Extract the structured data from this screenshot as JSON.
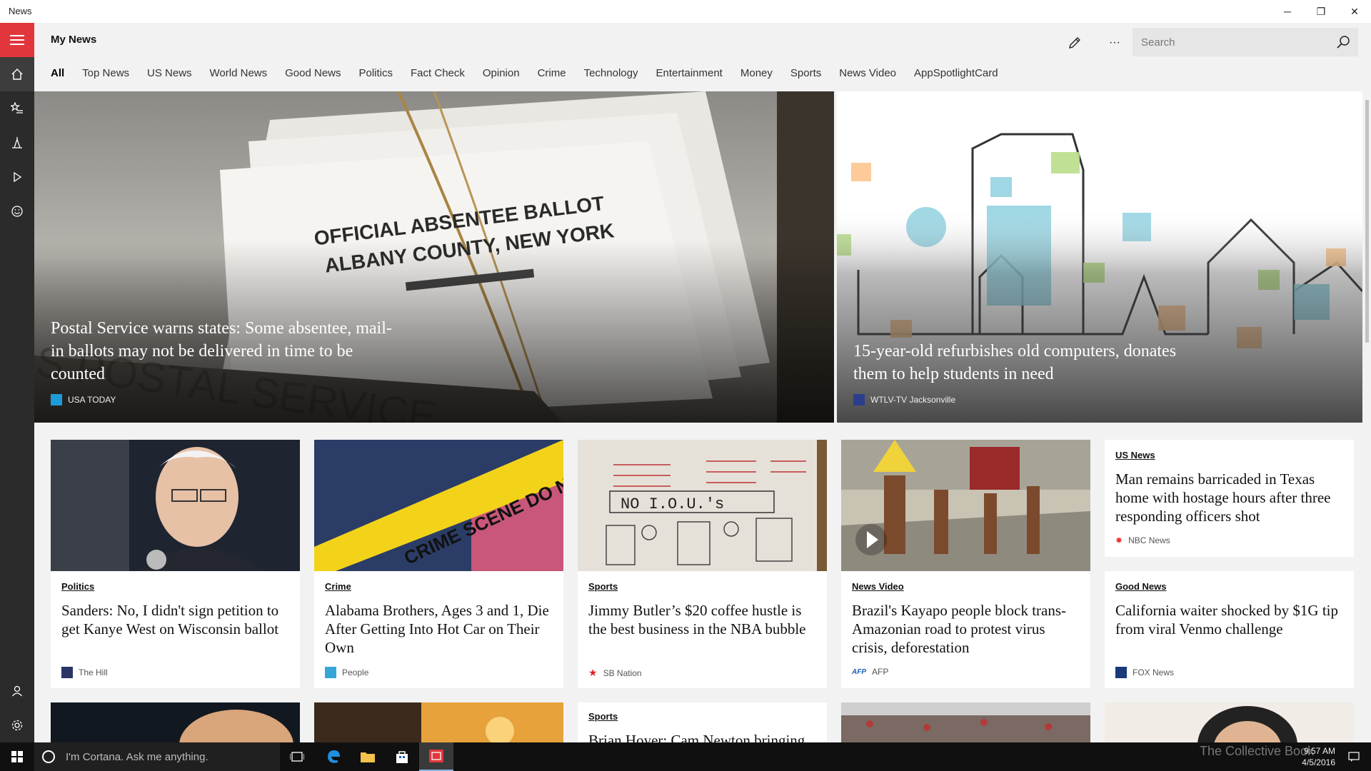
{
  "window": {
    "title": "News",
    "minimize": "─",
    "maximize": "❐",
    "close": "✕"
  },
  "header": {
    "page_title": "My News",
    "search_placeholder": "Search",
    "more_label": "···"
  },
  "tabs": [
    "All",
    "Top News",
    "US News",
    "World News",
    "Good News",
    "Politics",
    "Fact Check",
    "Opinion",
    "Crime",
    "Technology",
    "Entertainment",
    "Money",
    "Sports",
    "News Video",
    "AppSpotlightCard"
  ],
  "active_tab": "All",
  "hero": [
    {
      "headline": "Postal Service warns states: Some absentee, mail-in ballots may not be delivered in time to be counted",
      "line1": "Postal Service warns states: Some absentee, mail-",
      "line2": "in ballots may not be delivered in time to be",
      "line3": "counted",
      "source": "USA TODAY",
      "image_text_1": "OFFICIAL ABSENTEE BALLOT",
      "image_text_2": "ALBANY COUNTY, NEW YORK"
    },
    {
      "headline": "15-year-old refurbishes old computers, donates them to help students in need",
      "line1": "15-year-old refurbishes old computers, donates",
      "line2": "them to help students in need",
      "source": "WTLV-TV Jacksonville"
    }
  ],
  "cards_row1": [
    {
      "category": "Politics",
      "headline": "Sanders: No, I didn't sign petition to get Kanye West on Wisconsin ballot",
      "source": "The Hill"
    },
    {
      "category": "Crime",
      "headline": "Alabama Brothers, Ages 3 and 1, Die After Getting Into Hot Car on Their Own",
      "source": "People",
      "image_text": "CRIME SCENE DO NOT CROSS"
    },
    {
      "category": "Sports",
      "headline": "Jimmy Butler’s $20 coffee hustle is the best business in the NBA bubble",
      "source": "SB Nation",
      "image_text": "NO I.O.U.'s"
    },
    {
      "category": "News Video",
      "headline": "Brazil's Kayapo people block trans-Amazonian road to protest virus crisis, deforestation",
      "source": "AFP"
    }
  ],
  "text_cards": [
    {
      "category": "US News",
      "headline": "Man remains barricaded in Texas home with hostage hours after three responding officers shot",
      "source": "NBC News"
    },
    {
      "category": "Good News",
      "headline": "California waiter shocked by $1G tip from viral Venmo challenge",
      "source": "FOX News"
    }
  ],
  "cards_row2": [
    {
      "category": "Sports",
      "headline": "Brian Hoyer: Cam Newton bringing"
    }
  ],
  "taskbar": {
    "cortana_placeholder": "I'm Cortana. Ask me anything.",
    "time": "9:57 AM",
    "date": "4/5/2016",
    "watermark": "The Collective Book"
  },
  "colors": {
    "accent": "#e2363c",
    "rail": "#2b2b2b",
    "taskbar": "#101010"
  }
}
